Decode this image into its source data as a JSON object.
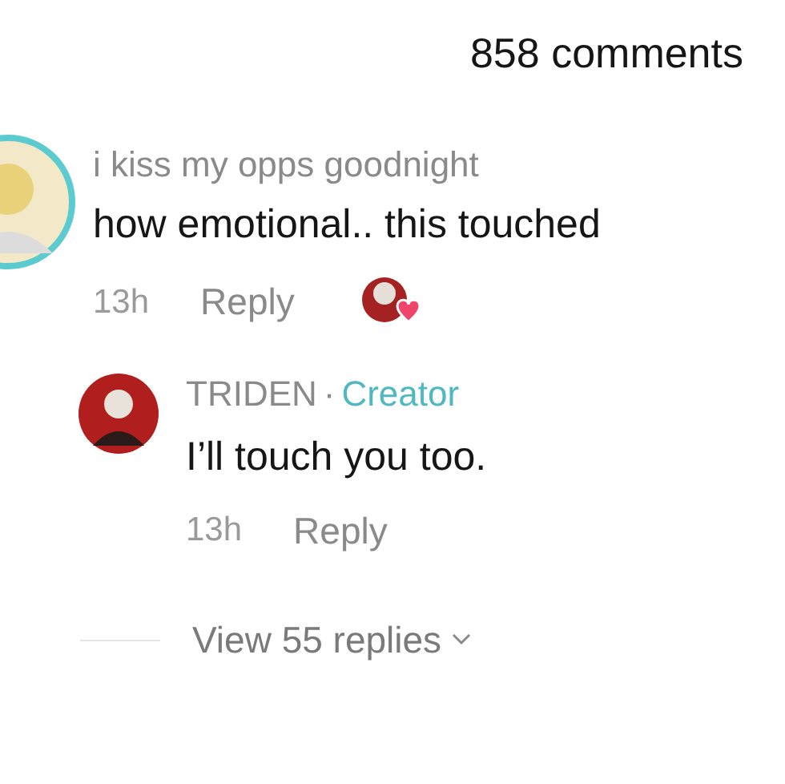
{
  "header": {
    "title": "858 comments"
  },
  "comment": {
    "username": "i kiss my opps goodnight",
    "text": "how emotional.. this touched",
    "time": "13h",
    "reply_label": "Reply",
    "liked_by_creator": true
  },
  "reply": {
    "username": "TRIDEN",
    "separator": "·",
    "badge": "Creator",
    "text": "I’ll touch you too.",
    "time": "13h",
    "reply_label": "Reply"
  },
  "view_replies": {
    "label": "View 55 replies"
  }
}
